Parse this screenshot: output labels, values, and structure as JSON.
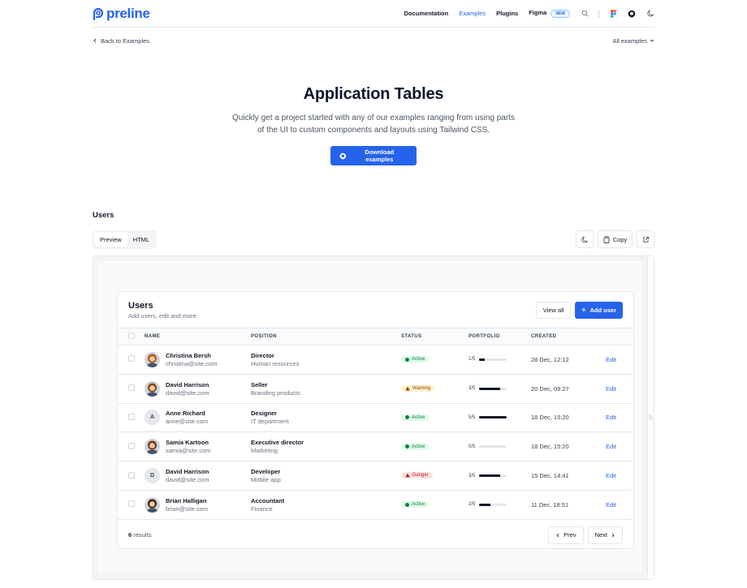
{
  "header": {
    "logo_text": "preline",
    "nav": [
      {
        "label": "Documentation",
        "active": false
      },
      {
        "label": "Examples",
        "active": true
      },
      {
        "label": "Plugins",
        "active": false
      },
      {
        "label": "Figma",
        "active": false
      }
    ],
    "figma_badge": "NEW"
  },
  "subbar": {
    "back_label": "Back to Examples",
    "all_examples_label": "All examples"
  },
  "hero": {
    "title": "Application Tables",
    "description": "Quickly get a project started with any of our examples ranging from using parts of the UI to custom components and layouts using Tailwind CSS.",
    "button_label": "Download examples"
  },
  "section": {
    "title": "Users",
    "tabs": [
      "Preview",
      "HTML"
    ],
    "copy_label": "Copy"
  },
  "card": {
    "title": "Users",
    "subtitle": "Add users, edit and more.",
    "view_all_label": "View all",
    "add_user_label": "Add user",
    "columns": [
      "NAME",
      "POSITION",
      "STATUS",
      "PORTFOLIO",
      "CREATED"
    ],
    "rows": [
      {
        "name": "Christina Bersh",
        "email": "christina@site.com",
        "avatar": "photo",
        "initial": "",
        "title": "Director",
        "dept": "Human resources",
        "status": "Active",
        "portfolio": "1/5",
        "portfolio_fraction": 0.2,
        "created": "28 Dec, 12:12",
        "action": "Edit"
      },
      {
        "name": "David Harrison",
        "email": "david@site.com",
        "avatar": "photo",
        "initial": "",
        "title": "Seller",
        "dept": "Branding products",
        "status": "Warning",
        "portfolio": "3/5",
        "portfolio_fraction": 0.75,
        "created": "20 Dec, 09:27",
        "action": "Edit"
      },
      {
        "name": "Anne Richard",
        "email": "anne@site.com",
        "avatar": "initial",
        "initial": "A",
        "title": "Designer",
        "dept": "IT department",
        "status": "Active",
        "portfolio": "5/5",
        "portfolio_fraction": 1.0,
        "created": "18 Dec, 15:20",
        "action": "Edit"
      },
      {
        "name": "Samia Kartoon",
        "email": "samia@site.com",
        "avatar": "photo",
        "initial": "",
        "title": "Executive director",
        "dept": "Marketing",
        "status": "Active",
        "portfolio": "0/5",
        "portfolio_fraction": 0.0,
        "created": "18 Dec, 15:20",
        "action": "Edit"
      },
      {
        "name": "David Harrison",
        "email": "david@site.com",
        "avatar": "initial",
        "initial": "D",
        "title": "Developer",
        "dept": "Mobile app",
        "status": "Danger",
        "portfolio": "3/5",
        "portfolio_fraction": 0.75,
        "created": "15 Dec, 14:41",
        "action": "Edit"
      },
      {
        "name": "Brian Halligan",
        "email": "brian@site.com",
        "avatar": "photo",
        "initial": "",
        "title": "Accountant",
        "dept": "Finance",
        "status": "Active",
        "portfolio": "2/5",
        "portfolio_fraction": 0.4,
        "created": "11 Dec, 18:51",
        "action": "Edit"
      }
    ],
    "results_count": "6",
    "results_label": "results",
    "prev_label": "Prev",
    "next_label": "Next"
  },
  "colors": {
    "accent": "#2563eb",
    "active_bg": "#dcfce7",
    "active_fg": "#15803d",
    "warning_bg": "#fef3c7",
    "warning_fg": "#92400e",
    "danger_bg": "#fee2e2",
    "danger_fg": "#b91c1c"
  },
  "icons": [
    "github-icon",
    "search-icon",
    "figma-icon",
    "moon-icon",
    "chevron-left-icon",
    "chevron-down-icon",
    "copy-icon",
    "external-link-icon",
    "plus-icon",
    "chevron-right-icon"
  ]
}
